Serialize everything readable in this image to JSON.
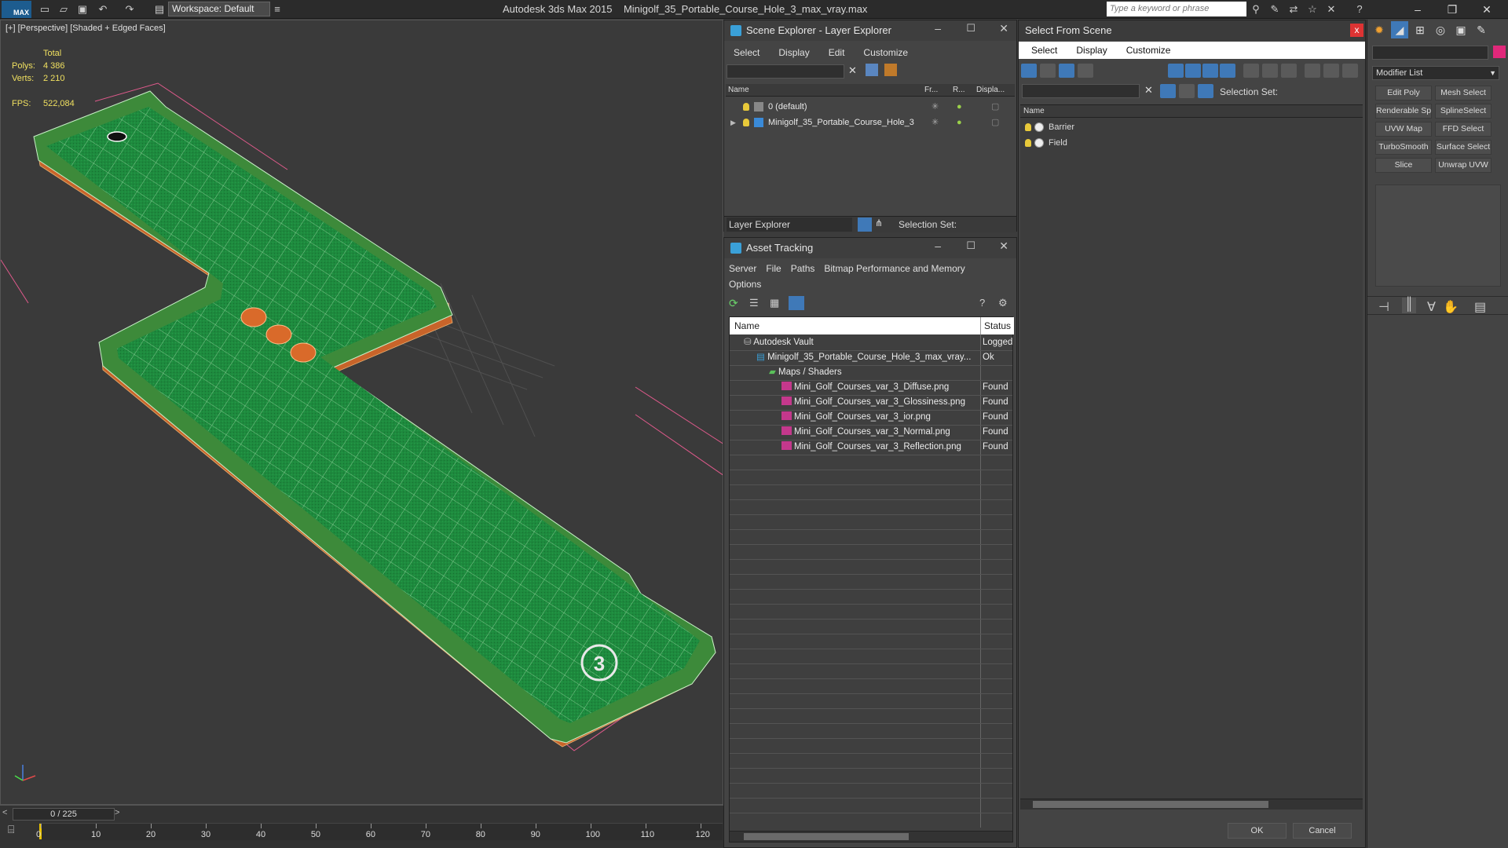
{
  "app": {
    "title": "Autodesk 3ds Max  2015",
    "file": "Minigolf_35_Portable_Course_Hole_3_max_vray.max",
    "workspace": "Workspace: Default",
    "search_placeholder": "Type a keyword or phrase",
    "logo": "MAX"
  },
  "viewport": {
    "label": "[+] [Perspective] [Shaded + Edged Faces]",
    "stats": {
      "total_label": "Total",
      "polys_label": "Polys:",
      "polys": "4 386",
      "verts_label": "Verts:",
      "verts": "2 210",
      "fps_label": "FPS:",
      "fps": "522,084"
    },
    "hole_number": "3",
    "colors": {
      "felt": "#1e8a3e",
      "border": "#3a7a2f",
      "side": "#c8642a",
      "wire": "#c8f0c8"
    }
  },
  "timeline": {
    "frame": "0 / 225",
    "prev": "<",
    "next": ">",
    "ticks": [
      "0",
      "10",
      "20",
      "30",
      "40",
      "50",
      "60",
      "70",
      "80",
      "90",
      "100",
      "110",
      "120"
    ]
  },
  "scene_explorer": {
    "title": "Scene Explorer - Layer Explorer",
    "menu": [
      "Select",
      "Display",
      "Edit",
      "Customize"
    ],
    "columns": {
      "name": "Name",
      "frozen": "Fr...",
      "render": "R...",
      "display": "Displa..."
    },
    "rows": [
      {
        "name": "0 (default)"
      },
      {
        "name": "Minigolf_35_Portable_Course_Hole_3"
      }
    ],
    "footer_dropdown": "Layer Explorer",
    "selection_set_label": "Selection Set:"
  },
  "asset_tracking": {
    "title": "Asset Tracking",
    "menu": [
      "Server",
      "File",
      "Paths",
      "Bitmap Performance and Memory"
    ],
    "menu2": [
      "Options"
    ],
    "columns": {
      "name": "Name",
      "status": "Status"
    },
    "rows": [
      {
        "name": "Autodesk Vault",
        "status": "Logged",
        "indent": 0
      },
      {
        "name": "Minigolf_35_Portable_Course_Hole_3_max_vray...",
        "status": "Ok",
        "indent": 1
      },
      {
        "name": "Maps / Shaders",
        "status": "",
        "indent": 2
      },
      {
        "name": "Mini_Golf_Courses_var_3_Diffuse.png",
        "status": "Found",
        "indent": 3
      },
      {
        "name": "Mini_Golf_Courses_var_3_Glossiness.png",
        "status": "Found",
        "indent": 3
      },
      {
        "name": "Mini_Golf_Courses_var_3_ior.png",
        "status": "Found",
        "indent": 3
      },
      {
        "name": "Mini_Golf_Courses_var_3_Normal.png",
        "status": "Found",
        "indent": 3
      },
      {
        "name": "Mini_Golf_Courses_var_3_Reflection.png",
        "status": "Found",
        "indent": 3
      }
    ]
  },
  "select_from_scene": {
    "title": "Select From Scene",
    "close": "x",
    "menu": [
      "Select",
      "Display",
      "Customize"
    ],
    "selection_set_label": "Selection Set:",
    "column_name": "Name",
    "items": [
      "Barrier",
      "Field"
    ],
    "ok": "OK",
    "cancel": "Cancel"
  },
  "command_panel": {
    "modifier_list": "Modifier List",
    "buttons": [
      "Edit Poly",
      "Mesh Select",
      "Renderable Spline",
      "SplineSelect",
      "UVW Map",
      "FFD Select",
      "TurboSmooth",
      "Surface Select",
      "Slice",
      "Unwrap UVW"
    ]
  }
}
